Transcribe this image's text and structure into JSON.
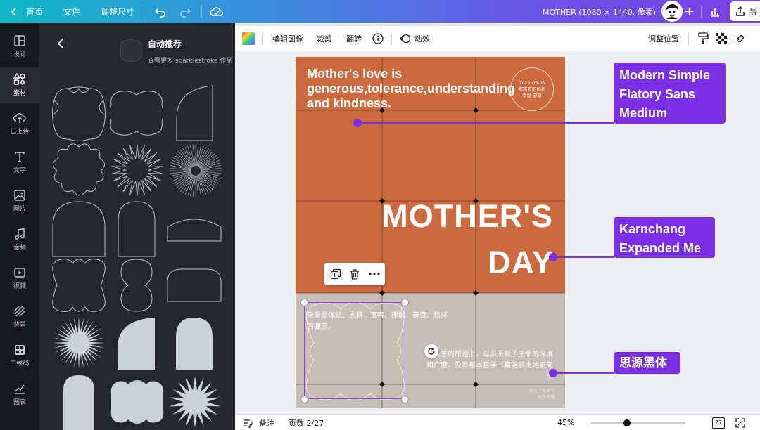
{
  "topbar": {
    "home": "首页",
    "file": "文件",
    "resize": "调整尺寸",
    "doc_title": "MOTHER (1080 × 1440, 像素)",
    "share_label": "导"
  },
  "rail": [
    {
      "label": "设计",
      "icon": "layout-icon"
    },
    {
      "label": "素材",
      "icon": "elements-icon"
    },
    {
      "label": "已上传",
      "icon": "upload-icon"
    },
    {
      "label": "文字",
      "icon": "text-icon"
    },
    {
      "label": "图片",
      "icon": "image-icon"
    },
    {
      "label": "音频",
      "icon": "audio-icon"
    },
    {
      "label": "视频",
      "icon": "video-icon"
    },
    {
      "label": "背景",
      "icon": "background-icon"
    },
    {
      "label": "二维码",
      "icon": "qrcode-icon"
    },
    {
      "label": "图表",
      "icon": "chart-icon"
    }
  ],
  "panel": {
    "title": "自动推荐",
    "subtitle": "查看更多 sparklestroke 作品"
  },
  "ctxbar": {
    "edit_image": "编辑图像",
    "crop": "裁剪",
    "flip": "翻转",
    "animate": "动效",
    "position": "调整位置"
  },
  "poster": {
    "headline": "Mother's love is generous,tolerance,understanding and kindness.",
    "date": "2022.05.08",
    "date_line2": "祝所有的妈妈",
    "date_line3": "幸福 安康",
    "title_line1": "MOTHER'S",
    "title_line2": "DAY",
    "cn_left": "母爱是体贴、慰藉、宽容、理解、善良、慈祥的源泉。",
    "cn_right": "在人生的旅途上，母亲所赋予生命的深度和广度，没有哪本哲学书籍能够比她更周全",
    "cn_small_1": "祝天下母亲节",
    "cn_small_2": "快乐幸福"
  },
  "annotations": {
    "a1_l1": "Modern Simple",
    "a1_l2": "Flatory Sans",
    "a1_l3": "Medium",
    "a2_l1": "Karnchang",
    "a2_l2": "Expanded Me",
    "a3": "思源黑体"
  },
  "bottombar": {
    "notes": "备注",
    "pages": "页数 2/27",
    "zoom": "45%",
    "page_count": "27",
    "zoom_fraction": 0.45
  },
  "colors": {
    "poster_orange": "#cc6a3f",
    "poster_bottom": "#c7bdb7",
    "annotation_purple": "#7a2fe3",
    "panel_bg": "#25272b"
  }
}
